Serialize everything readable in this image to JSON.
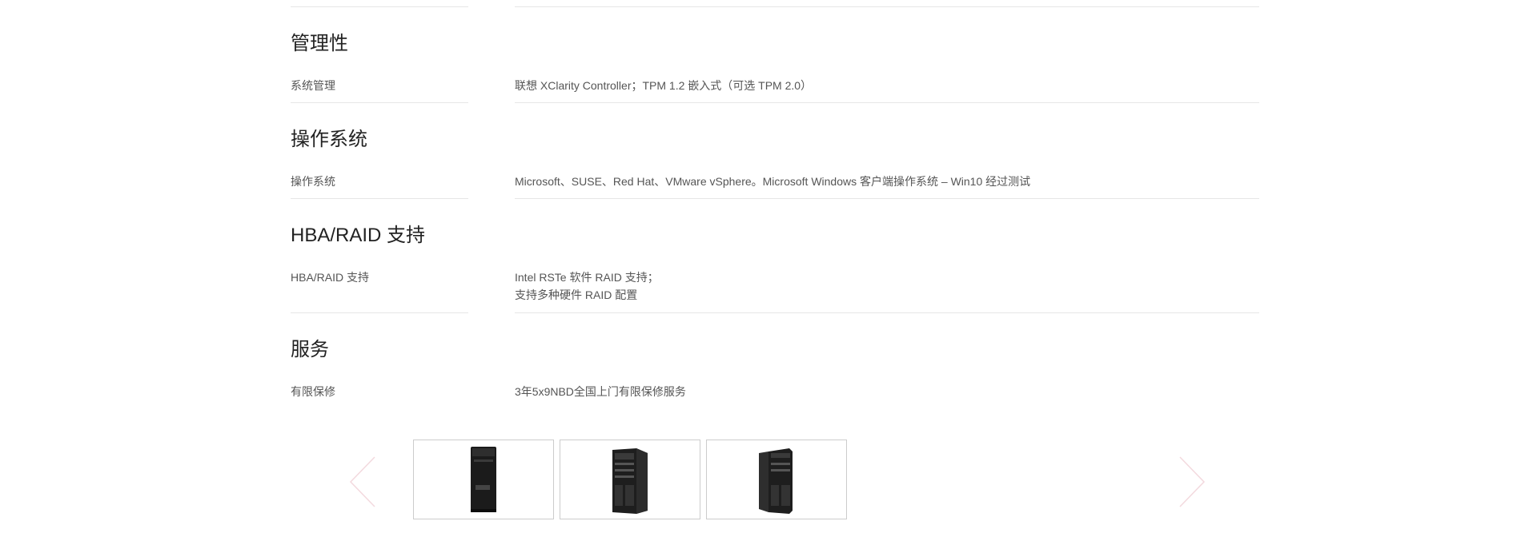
{
  "sections": [
    {
      "title": "管理性",
      "label": "系统管理",
      "value_lines": [
        "联想 XClarity Controller；TPM 1.2 嵌入式（可选 TPM 2.0）"
      ]
    },
    {
      "title": "操作系统",
      "label": "操作系统",
      "value_lines": [
        "Microsoft、SUSE、Red Hat、VMware vSphere。Microsoft Windows 客户端操作系统 – Win10 经过测试"
      ]
    },
    {
      "title": "HBA/RAID 支持",
      "label": "HBA/RAID 支持",
      "value_lines": [
        "Intel RSTe 软件 RAID 支持；",
        "支持多种硬件 RAID 配置"
      ]
    },
    {
      "title": "服务",
      "label": "有限保修",
      "value_lines": [
        "3年5x9NBD全国上门有限保修服务"
      ]
    }
  ],
  "carousel": {
    "arrow_color": "#f3d9de",
    "thumbnails": [
      {
        "icon": "tower-server-front-icon"
      },
      {
        "icon": "tower-server-angled-icon"
      },
      {
        "icon": "tower-server-angled-icon"
      }
    ]
  },
  "colors": {
    "rule": "#e6e6e6",
    "title": "#222222",
    "text": "#555555"
  }
}
